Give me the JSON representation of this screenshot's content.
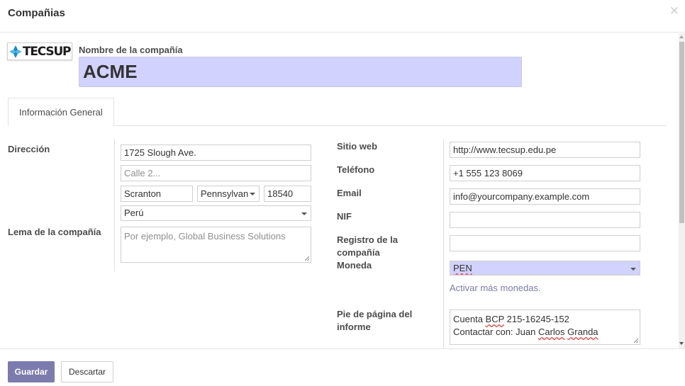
{
  "modal": {
    "title": "Compañias",
    "close_glyph": "×"
  },
  "logo": {
    "text": "TECSUP",
    "icon": "tecsup-logo-icon"
  },
  "company": {
    "name_label": "Nombre de la compañía",
    "name_value": "ACME"
  },
  "tabs": [
    {
      "label": "Información General"
    }
  ],
  "left": {
    "address_label": "Dirección",
    "street": "1725 Slough Ave.",
    "street2_placeholder": "Calle 2...",
    "city": "Scranton",
    "state": "Pennsylvan",
    "zip": "18540",
    "country": "Perú",
    "tagline_label": "Lema de la compañía",
    "tagline_placeholder": "Por ejemplo, Global Business Solutions"
  },
  "right": {
    "website_label": "Sitio web",
    "website": "http://www.tecsup.edu.pe",
    "phone_label": "Teléfono",
    "phone": "+1 555 123 8069",
    "email_label": "Email",
    "email": "info@yourcompany.example.com",
    "nif_label": "NIF",
    "nif": "",
    "registry_label_1": "Registro de la",
    "registry_label_2": "compañía",
    "registry": "",
    "currency_label": "Moneda",
    "currency": "PEN",
    "more_currencies_link": "Activar más monedas.",
    "footer_label_1": "Pie de página del",
    "footer_label_2": "informe",
    "report_footer_line1_a": "Cuenta ",
    "report_footer_line1_b": "BCP",
    "report_footer_line1_c": " 215-16245-152",
    "report_footer_line2_a": "Contactar con: Juan ",
    "report_footer_line2_b": "Carlos",
    "report_footer_line2_c": " ",
    "report_footer_line2_d": "Granda"
  },
  "buttons": {
    "save": "Guardar",
    "discard": "Descartar"
  },
  "colors": {
    "accent": "#7c7bad",
    "required_field": "#d2d2ff"
  }
}
